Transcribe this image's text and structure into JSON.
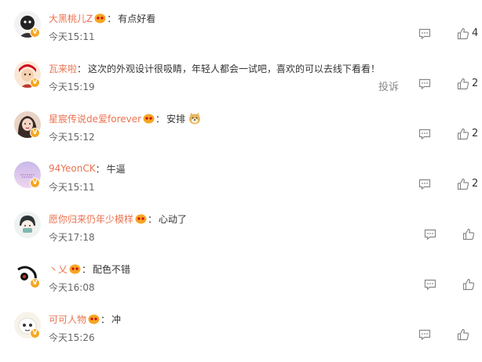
{
  "comments": [
    {
      "name": "大黑桃儿Z",
      "text": "有点好看",
      "time": "今天15:11",
      "likes": "4"
    },
    {
      "name": "瓦来啦",
      "text": "这次的外观设计很吸睛，年轻人都会一试吧，喜欢的可以去线下看看！",
      "time": "今天15:19",
      "likes": "2",
      "report": "投诉"
    },
    {
      "name": "星宸传说de爱forever",
      "text": "安排",
      "time": "今天15:12",
      "likes": "2"
    },
    {
      "name": "94YeonCK",
      "text": "牛逼",
      "time": "今天15:11",
      "likes": "2"
    },
    {
      "name": "愿你归来仍年少模样",
      "text": "心动了",
      "time": "今天17:18"
    },
    {
      "name": "丶乂",
      "text": "配色不错",
      "time": "今天16:08"
    },
    {
      "name": "可可人物",
      "text": "冲",
      "time": "今天15:26"
    }
  ],
  "colors": {
    "username": "#eb7350",
    "badge": "#f4a825"
  }
}
